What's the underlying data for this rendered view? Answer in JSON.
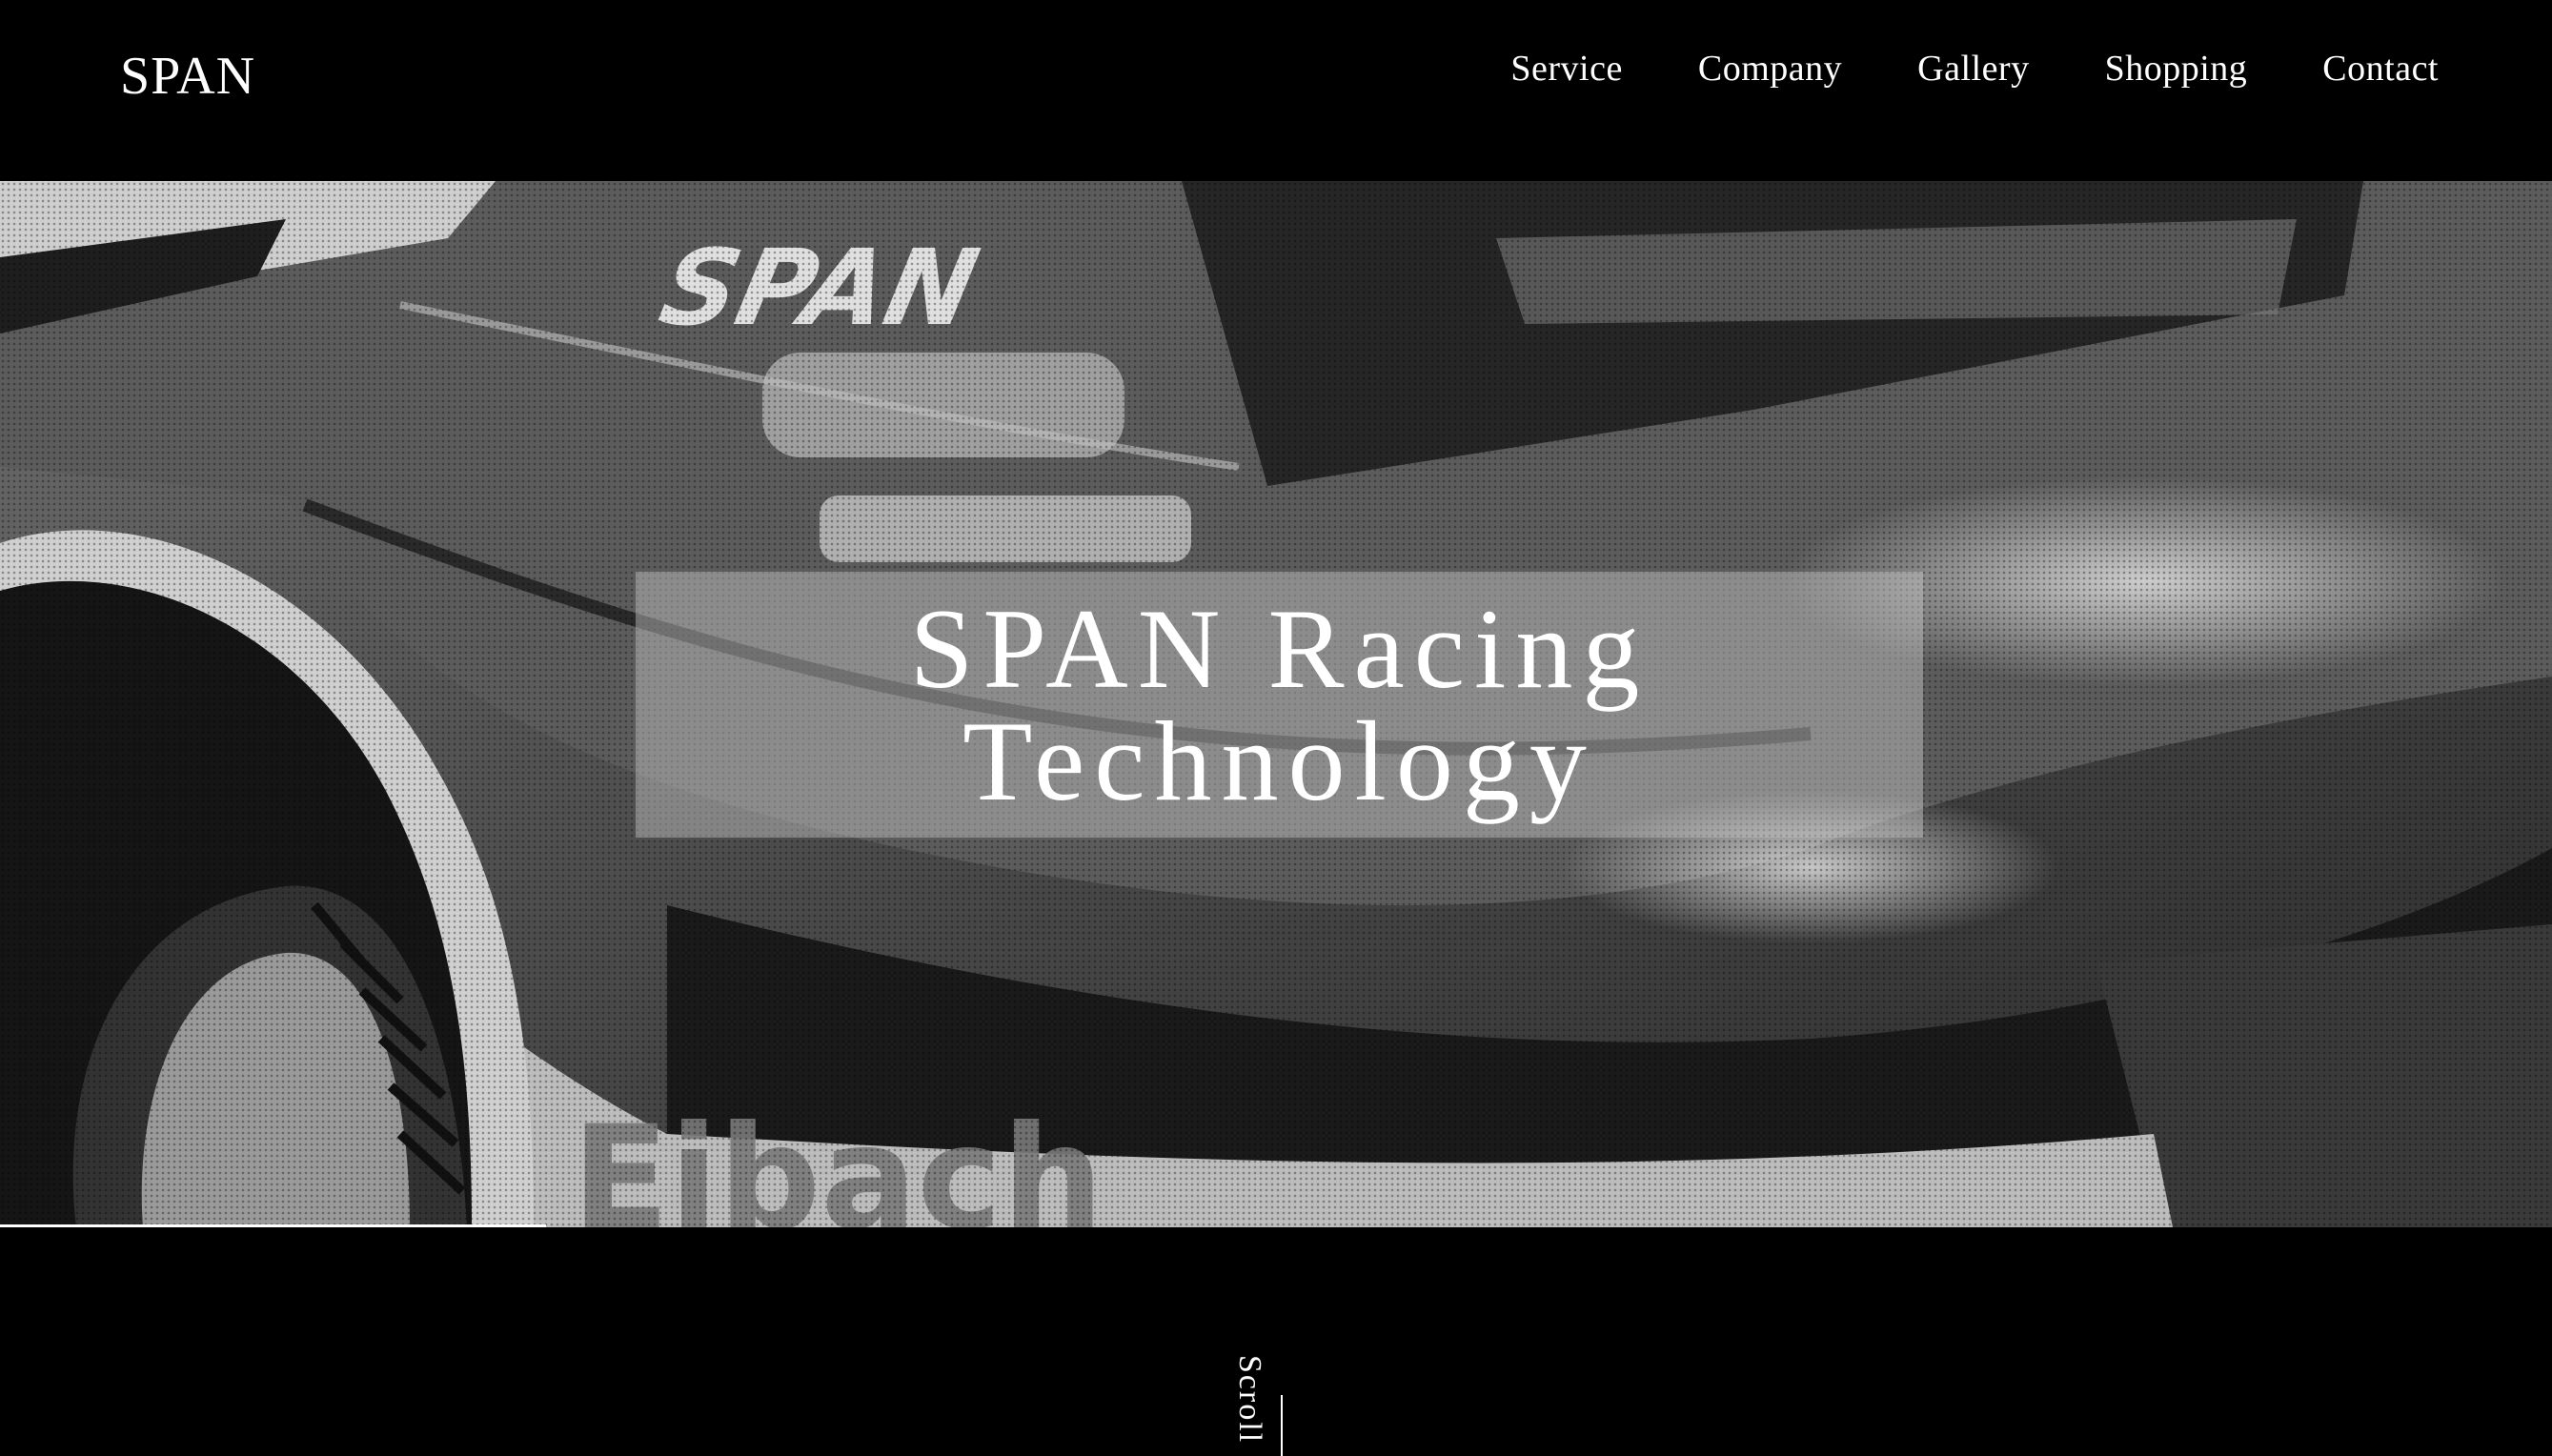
{
  "header": {
    "logo": "SPAN",
    "nav": [
      "Service",
      "Company",
      "Gallery",
      "Shopping",
      "Contact"
    ]
  },
  "hero": {
    "title_line1": "SPAN Racing",
    "title_line2": "Technology",
    "decal_span": "SPAN",
    "decal_sponsor": "Eibach",
    "colors": {
      "overlay_box": "#c8c8c8",
      "background": "#000000",
      "text": "#ffffff"
    }
  },
  "scroll": {
    "label": "Scroll"
  }
}
